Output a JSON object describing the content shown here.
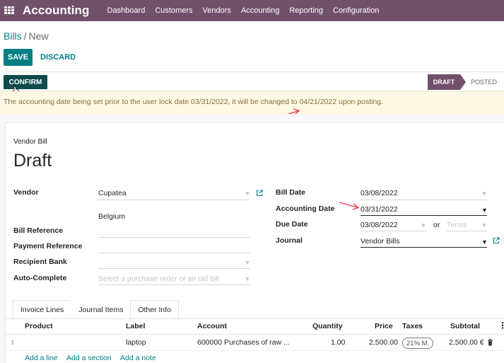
{
  "topbar": {
    "brand": "Accounting",
    "menu": [
      "Dashboard",
      "Customers",
      "Vendors",
      "Accounting",
      "Reporting",
      "Configuration"
    ]
  },
  "breadcrumb": {
    "parent": "Bills",
    "separator": "/",
    "current": "New"
  },
  "buttons": {
    "save": "SAVE",
    "discard": "DISCARD",
    "confirm": "CONFIRM"
  },
  "status": {
    "draft": "DRAFT",
    "posted": "POSTED"
  },
  "warning": "The accounting date being set prior to the user lock date 03/31/2022, it will be changed to 04/21/2022 upon posting.",
  "form": {
    "doc_type": "Vendor Bill",
    "title": "Draft",
    "vendor_label": "Vendor",
    "vendor_value": "Cupatea",
    "vendor_country": "Belgium",
    "bill_reference_label": "Bill Reference",
    "payment_reference_label": "Payment Reference",
    "recipient_bank_label": "Recipient Bank",
    "auto_complete_label": "Auto-Complete",
    "auto_complete_placeholder": "Select a purchase order or an old bill",
    "bill_date_label": "Bill Date",
    "bill_date_value": "03/08/2022",
    "accounting_date_label": "Accounting Date",
    "accounting_date_value": "03/31/2022",
    "due_date_label": "Due Date",
    "due_date_value": "03/08/2022",
    "or_label": "or",
    "terms_placeholder": "Terms",
    "journal_label": "Journal",
    "journal_value": "Vendor Bills"
  },
  "tabs": [
    "Invoice Lines",
    "Journal Items",
    "Other Info"
  ],
  "table": {
    "headers": {
      "product": "Product",
      "label": "Label",
      "account": "Account",
      "quantity": "Quantity",
      "price": "Price",
      "taxes": "Taxes",
      "subtotal": "Subtotal"
    },
    "row": {
      "label": "laptop",
      "account": "600000 Purchases of raw ...",
      "quantity": "1.00",
      "price": "2,500.00",
      "tax": "21% M.",
      "subtotal": "2,500.00 €"
    }
  },
  "add_links": {
    "line": "Add a line",
    "section": "Add a section",
    "note": "Add a note"
  },
  "colors": {
    "brand": "#71506b",
    "primary": "#017e84",
    "confirm": "#0f4a4d",
    "warning_bg": "#fcf8e3",
    "annotation_arrow": "#e8364f"
  }
}
